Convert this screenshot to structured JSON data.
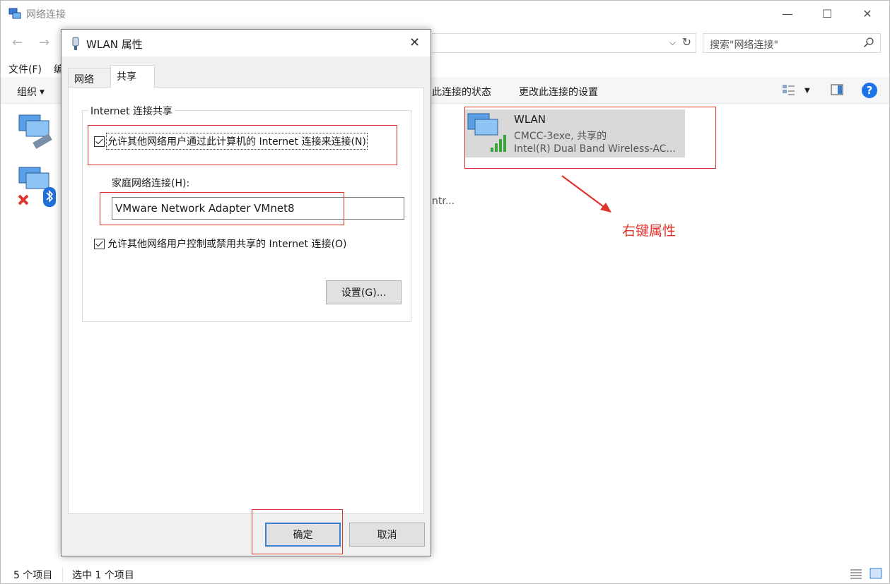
{
  "window": {
    "title": "网络连接",
    "search_placeholder": "搜索\"网络连接\""
  },
  "menubar": {
    "file": "文件(F)",
    "edit_partial": "编"
  },
  "commandbar": {
    "organize": "组织",
    "view_status": "此连接的状态",
    "change_settings": "更改此连接的设置"
  },
  "connections": {
    "wlan": {
      "name": "WLAN",
      "status": "CMCC-3exe, 共享的",
      "device": "Intel(R) Dual Band Wireless-AC..."
    },
    "partial_text": "ntr..."
  },
  "annotation": {
    "text": "右键属性",
    "color": "#e0342b"
  },
  "statusbar": {
    "count": "5 个项目",
    "selected": "选中 1 个项目"
  },
  "dialog": {
    "title": "WLAN 属性",
    "tabs": [
      "网络",
      "共享"
    ],
    "active_tab": "共享",
    "group_label": "Internet 连接共享",
    "allow_share_label": "允许其他网络用户通过此计算机的 Internet 连接来连接(N)",
    "allow_share_checked": true,
    "home_network_label": "家庭网络连接(H):",
    "home_network_value": "VMware Network Adapter VMnet8",
    "allow_control_label": "允许其他网络用户控制或禁用共享的 Internet 连接(O)",
    "allow_control_checked": true,
    "settings_button": "设置(G)...",
    "ok_button": "确定",
    "cancel_button": "取消"
  }
}
